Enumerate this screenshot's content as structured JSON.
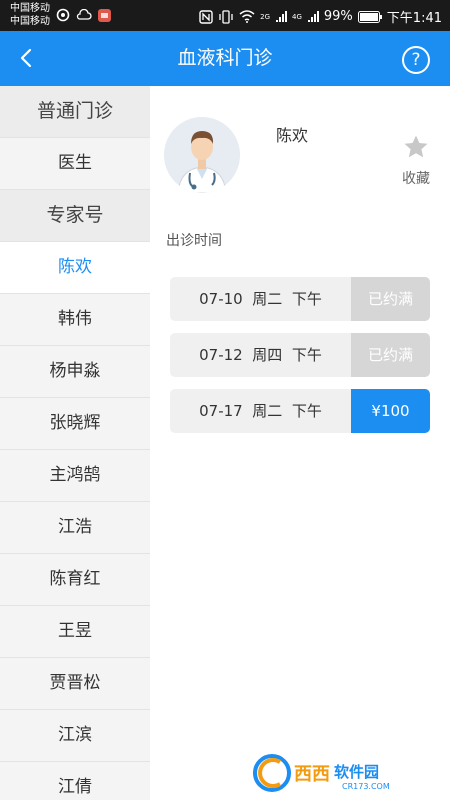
{
  "status_bar": {
    "carrier_1": "中国移动",
    "carrier_2": "中国移动",
    "network_2g": "2G",
    "network_4g": "4G",
    "battery": "99%",
    "time": "下午1:41"
  },
  "header": {
    "title": "血液科门诊",
    "back_icon": "chevron-left-icon",
    "help_label": "?"
  },
  "sidebar": {
    "section_general": "普通门诊",
    "general_items": [
      "医生"
    ],
    "section_expert": "专家号",
    "expert_items": [
      "陈欢",
      "韩伟",
      "杨申淼",
      "张晓辉",
      "主鸿鹄",
      "江浩",
      "陈育红",
      "王昱",
      "贾晋松",
      "江滨",
      "江倩"
    ],
    "active_index": 0
  },
  "doctor": {
    "name": "陈欢",
    "favorite_label": "收藏",
    "favorite_icon": "star-icon"
  },
  "schedule": {
    "title": "出诊时间",
    "slots": [
      {
        "date": "07-10",
        "weekday": "周二",
        "period": "下午",
        "status": "已约满",
        "available": false
      },
      {
        "date": "07-12",
        "weekday": "周四",
        "period": "下午",
        "status": "已约满",
        "available": false
      },
      {
        "date": "07-17",
        "weekday": "周二",
        "period": "下午",
        "status": "¥100",
        "available": true
      }
    ]
  },
  "watermark": {
    "brand_text": "西西",
    "suffix_text": "软件园",
    "site": "CR173.COM"
  },
  "colors": {
    "accent": "#1c8ef2",
    "full_slot": "#d6d6d6"
  }
}
